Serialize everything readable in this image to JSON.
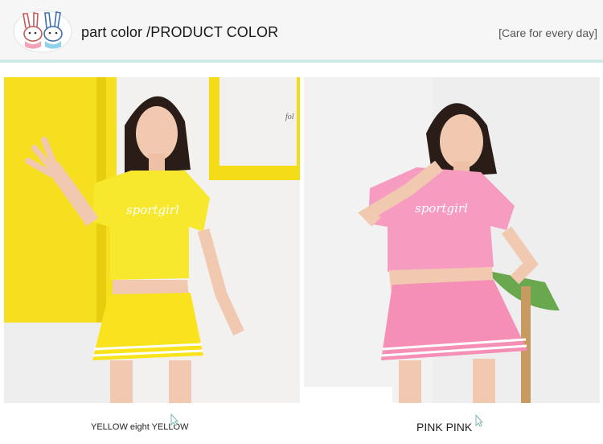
{
  "header": {
    "title": "part color /PRODUCT COLOR",
    "tagline": "[Care for every day]",
    "logo_icon": "two-bunnies-logo"
  },
  "products": [
    {
      "caption": "YELLOW eight YELLOW",
      "color": "#f4e11c",
      "shirt_text": "sportgirl"
    },
    {
      "caption": "PINK PINK",
      "color": "#f28fb6",
      "shirt_text": "sportgirl"
    }
  ],
  "colors": {
    "header_bg": "#f6f6f7",
    "accent_line": "#cfe9e4",
    "yellow_wall": "#f6df1e",
    "pink_outfit": "#f28fb6"
  }
}
